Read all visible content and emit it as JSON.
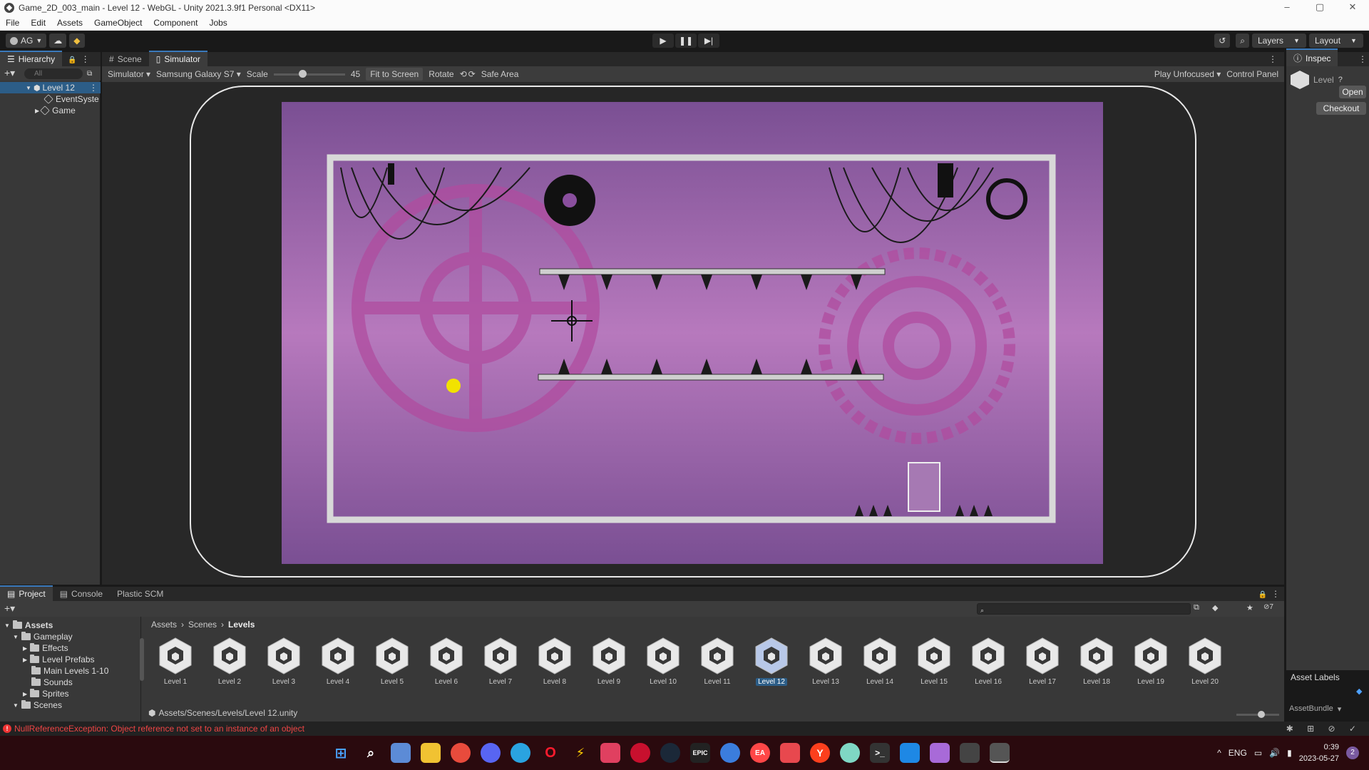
{
  "window": {
    "title": "Game_2D_003_main - Level 12 - WebGL - Unity 2021.3.9f1 Personal <DX11>",
    "controls": [
      "–",
      "▢",
      "✕"
    ]
  },
  "menu": [
    "File",
    "Edit",
    "Assets",
    "GameObject",
    "Component",
    "Jobs"
  ],
  "toolbar": {
    "account": "AG",
    "layers_label": "Layers",
    "layout_label": "Layout"
  },
  "hierarchy": {
    "tab_label": "Hierarchy",
    "search_placeholder": "All",
    "items": [
      {
        "label": "Level 12"
      },
      {
        "label": "EventSyste"
      },
      {
        "label": "Game"
      }
    ]
  },
  "simulator": {
    "tabs": [
      {
        "label": "Scene"
      },
      {
        "label": "Simulator"
      }
    ],
    "mode_dropdown": "Simulator",
    "device_dropdown": "Samsung Galaxy S7",
    "scale_label": "Scale",
    "scale_value": "45",
    "scale_fraction": 0.4,
    "fit_button": "Fit to Screen",
    "rotate_label": "Rotate",
    "safe_area_label": "Safe Area",
    "play_mode_dropdown": "Play Unfocused",
    "control_panel_label": "Control Panel"
  },
  "inspector": {
    "tab_label": "Inspec",
    "asset_name": "Level",
    "open_button": "Open",
    "checkout_button": "Checkout",
    "asset_labels": "Asset Labels",
    "asset_bundle": "AssetBundle"
  },
  "project": {
    "tabs": [
      {
        "label": "Project"
      },
      {
        "label": "Console"
      },
      {
        "label": "Plastic SCM"
      }
    ],
    "tree": [
      {
        "label": "Assets",
        "level": 0
      },
      {
        "label": "Gameplay",
        "level": 1
      },
      {
        "label": "Effects",
        "level": 2
      },
      {
        "label": "Level Prefabs",
        "level": 2
      },
      {
        "label": "Main Levels 1-10",
        "level": 2
      },
      {
        "label": "Sounds",
        "level": 2
      },
      {
        "label": "Sprites",
        "level": 2
      },
      {
        "label": "Scenes",
        "level": 0
      }
    ],
    "breadcrumb": [
      "Assets",
      "Scenes",
      "Levels"
    ],
    "assets": [
      "Level 1",
      "Level 2",
      "Level 3",
      "Level 4",
      "Level 5",
      "Level 6",
      "Level 7",
      "Level 8",
      "Level 9",
      "Level 10",
      "Level 11",
      "Level 12",
      "Level 13",
      "Level 14",
      "Level 15",
      "Level 16",
      "Level 17",
      "Level 18",
      "Level 19",
      "Level 20"
    ],
    "selected_asset": "Level 12",
    "selected_path": "Assets/Scenes/Levels/Level 12.unity",
    "hidden_count": "7"
  },
  "status": {
    "error_message": "NullReferenceException: Object reference not set to an instance of an object"
  },
  "taskbar": {
    "language": "ENG",
    "time": "0:39",
    "date": "2023-05-27",
    "notification_count": "2",
    "epic_label": "EPIC",
    "ea_label": "EA"
  },
  "colors": {
    "accent": "#3a79bb",
    "selection": "#2c5d87",
    "game_bg": "#8e4f9e",
    "error": "#e44444"
  }
}
